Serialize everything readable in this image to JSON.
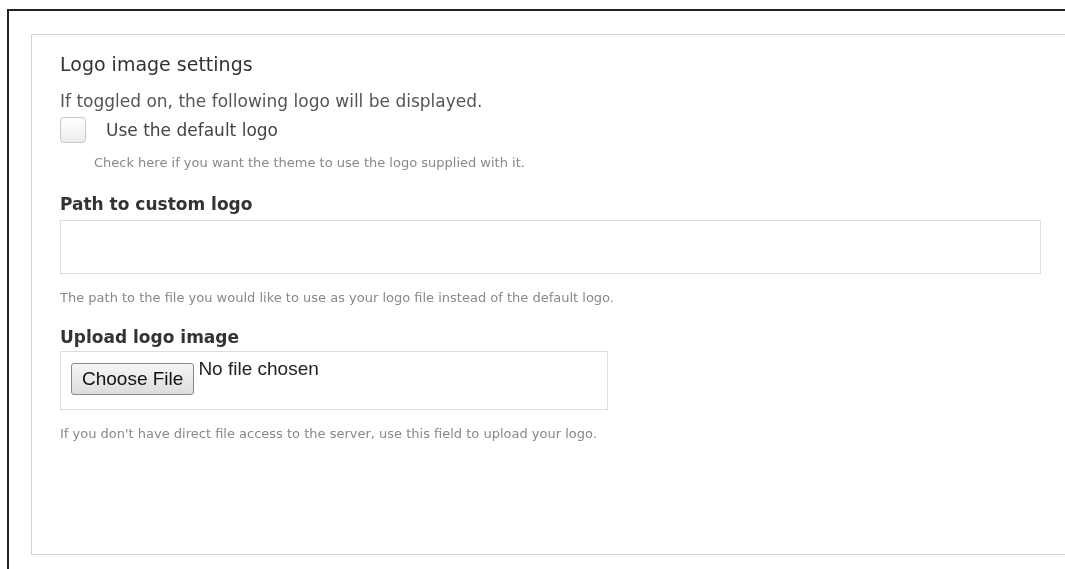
{
  "fieldset": {
    "legend": "Logo image settings",
    "description": "If toggled on, the following logo will be displayed.",
    "checkbox": {
      "label": "Use the default logo",
      "checked": false,
      "hint": "Check here if you want the theme to use the logo supplied with it."
    },
    "path_field": {
      "label": "Path to custom logo",
      "hint": "The path to the file you would like to use as your logo file instead of the default logo."
    },
    "upload": {
      "label": "Upload logo image",
      "button": "Choose File",
      "status": "No file chosen",
      "hint": "If you don't have direct file access to the server, use this field to upload your logo."
    }
  }
}
